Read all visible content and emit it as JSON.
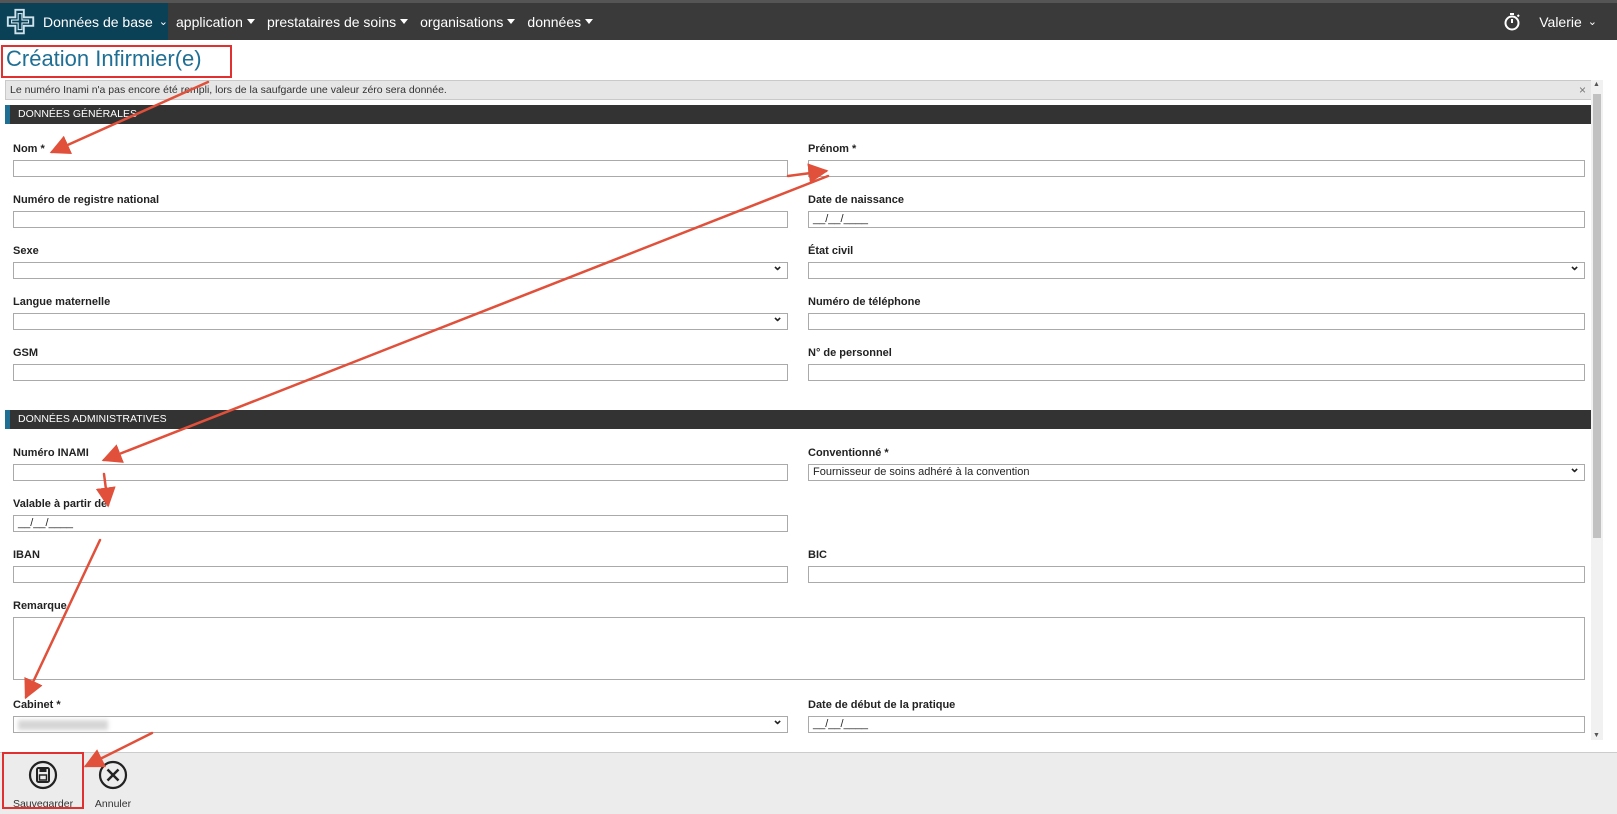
{
  "nav": {
    "brand": "Données de base",
    "menu": [
      "application",
      "prestataires de soins",
      "organisations",
      "données"
    ],
    "user": "Valerie"
  },
  "page": {
    "title": "Création Infirmier(e)"
  },
  "alert": {
    "text": "Le numéro Inami n'a pas encore été rempli, lors de la saufgarde une valeur zéro sera donnée.",
    "close": "×"
  },
  "sections": {
    "general": "DONNÉES GÉNÉRALES",
    "admin": "DONNÉES ADMINISTRATIVES"
  },
  "fields": {
    "nom": {
      "label": "Nom *",
      "value": ""
    },
    "prenom": {
      "label": "Prénom *",
      "value": ""
    },
    "registre": {
      "label": "Numéro de registre national",
      "value": ""
    },
    "naissance": {
      "label": "Date de naissance",
      "value": "__/__/____"
    },
    "sexe": {
      "label": "Sexe",
      "value": ""
    },
    "etat_civil": {
      "label": "État civil",
      "value": ""
    },
    "langue": {
      "label": "Langue maternelle",
      "value": ""
    },
    "telephone": {
      "label": "Numéro de téléphone",
      "value": ""
    },
    "gsm": {
      "label": "GSM",
      "value": ""
    },
    "personnel": {
      "label": "N° de personnel",
      "value": ""
    },
    "inami": {
      "label": "Numéro INAMI",
      "value": ""
    },
    "conventionne": {
      "label": "Conventionné *",
      "value": "Fournisseur de soins adhéré à la convention"
    },
    "valable": {
      "label": "Valable à partir de",
      "value": "__/__/____"
    },
    "iban": {
      "label": "IBAN",
      "value": ""
    },
    "bic": {
      "label": "BIC",
      "value": ""
    },
    "remarque": {
      "label": "Remarque",
      "value": ""
    },
    "cabinet": {
      "label": "Cabinet *",
      "value": ""
    },
    "debut_pratique": {
      "label": "Date de début de la pratique",
      "value": "__/__/____"
    }
  },
  "footer": {
    "save": "Sauvegarder",
    "cancel": "Annuler"
  },
  "colors": {
    "brand_bg": "#0b4157",
    "topbar_bg": "#3a3a3a",
    "title": "#1f6f95",
    "annotation": "#e03030"
  }
}
